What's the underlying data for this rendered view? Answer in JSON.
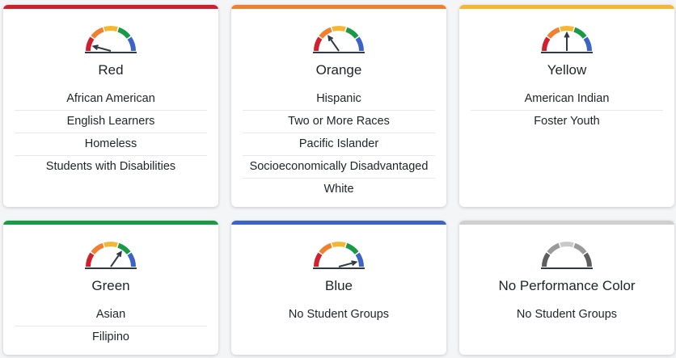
{
  "colors": {
    "red": "#d0202e",
    "orange": "#f07f2e",
    "yellow": "#f5b731",
    "green": "#1a9a47",
    "blue": "#3d63c7",
    "gray": "#cfcfcf",
    "needle": "#2f3a46"
  },
  "cards": [
    {
      "title": "Red",
      "level": "red",
      "gauge_icon": "gauge-red-icon",
      "items": [
        "African American",
        "English Learners",
        "Homeless",
        "Students with Disabilities"
      ]
    },
    {
      "title": "Orange",
      "level": "orange",
      "gauge_icon": "gauge-orange-icon",
      "items": [
        "Hispanic",
        "Two or More Races",
        "Pacific Islander",
        "Socioeconomically Disadvantaged",
        "White"
      ]
    },
    {
      "title": "Yellow",
      "level": "yellow",
      "gauge_icon": "gauge-yellow-icon",
      "items": [
        "American Indian",
        "Foster Youth"
      ]
    },
    {
      "title": "Green",
      "level": "green",
      "gauge_icon": "gauge-green-icon",
      "items": [
        "Asian",
        "Filipino"
      ]
    },
    {
      "title": "Blue",
      "level": "blue",
      "gauge_icon": "gauge-blue-icon",
      "items": [
        "No Student Groups"
      ]
    },
    {
      "title": "No Performance Color",
      "level": "none",
      "gauge_icon": "gauge-none-icon",
      "items": [
        "No Student Groups"
      ]
    }
  ]
}
